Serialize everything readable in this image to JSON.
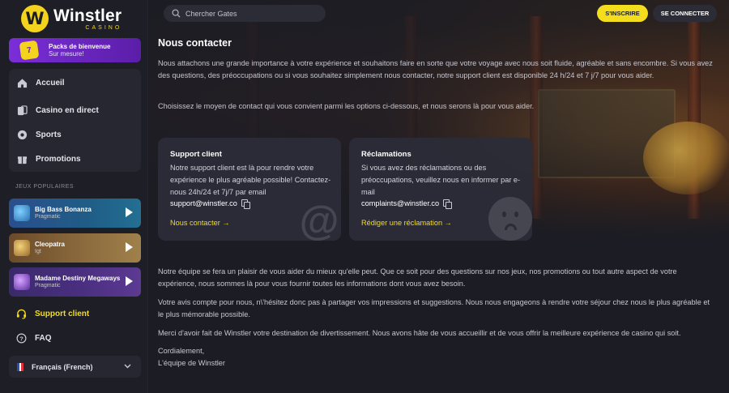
{
  "brand": {
    "logo_glyph": "W",
    "name": "Winstler",
    "sub": "CASINO",
    "accent": "#f4dd1d"
  },
  "promo": {
    "icon_text": "7",
    "title": "Packs de bienvenue",
    "subtitle": "Sur mesure!",
    "color": "#6a24c4"
  },
  "nav": [
    {
      "label": "Accueil",
      "icon": "home-icon"
    },
    {
      "label": "Casino en direct",
      "icon": "cards-icon"
    },
    {
      "label": "Sports",
      "icon": "ball-icon"
    },
    {
      "label": "Promotions",
      "icon": "gift-icon"
    }
  ],
  "popular_section_label": "JEUX POPULAIRES",
  "games": [
    {
      "title": "Big Bass Bonanza",
      "provider": "Pragmatic"
    },
    {
      "title": "Cleopatra",
      "provider": "Igt"
    },
    {
      "title": "Madame Destiny Megaways",
      "provider": "Pragmatic"
    }
  ],
  "support_link": "Support client",
  "faq_link": "FAQ",
  "language": "Français (French)",
  "search": {
    "placeholder": "Chercher Gates"
  },
  "header": {
    "signup_label": "S'INSCRIRE",
    "login_label": "SE CONNECTER"
  },
  "content": {
    "title": "Nous contacter",
    "intro": "Nous attachons une grande importance à votre expérience et souhaitons faire en sorte que votre voyage avec nous soit fluide, agréable et sans encombre. Si vous avez des questions, des préoccupations ou si vous souhaitez simplement nous contacter, notre support client est disponible 24 h/24 et 7 j/7 pour vous aider.",
    "choose": "Choisissez le moyen de contact qui vous convient parmi les options ci-dessous, et nous serons là pour vous aider.",
    "cards": [
      {
        "title": "Support client",
        "description": "Notre support client est là pour rendre votre expérience le plus agréable possible! Contactez-nous 24h/24 et 7j/7 par email",
        "email": "support@winstler.co",
        "link": "Nous contacter →"
      },
      {
        "title": "Réclamations",
        "description": "Si vous avez des réclamations ou des préoccupations, veuillez nous en informer par e-mail",
        "email": "complaints@winstler.co",
        "link": "Rédiger une réclamation →"
      }
    ],
    "p1": "Notre équipe se fera un plaisir de vous aider du mieux qu'elle peut. Que ce soit pour des questions sur nos jeux, nos promotions ou tout autre aspect de votre expérience, nous sommes là pour vous fournir toutes les informations dont vous avez besoin.",
    "p2": "Votre avis compte pour nous, n\\'hésitez donc pas à partager vos impressions et suggestions. Nous nous engageons à rendre votre séjour chez nous le plus agréable et le plus mémorable possible.",
    "p3": "Merci d'avoir fait de Winstler votre destination de divertissement. Nous avons hâte de vous accueillir et de vous offrir la meilleure expérience de casino qui soit.",
    "closing": "Cordialement,",
    "signature": "L'équipe de Winstler"
  }
}
